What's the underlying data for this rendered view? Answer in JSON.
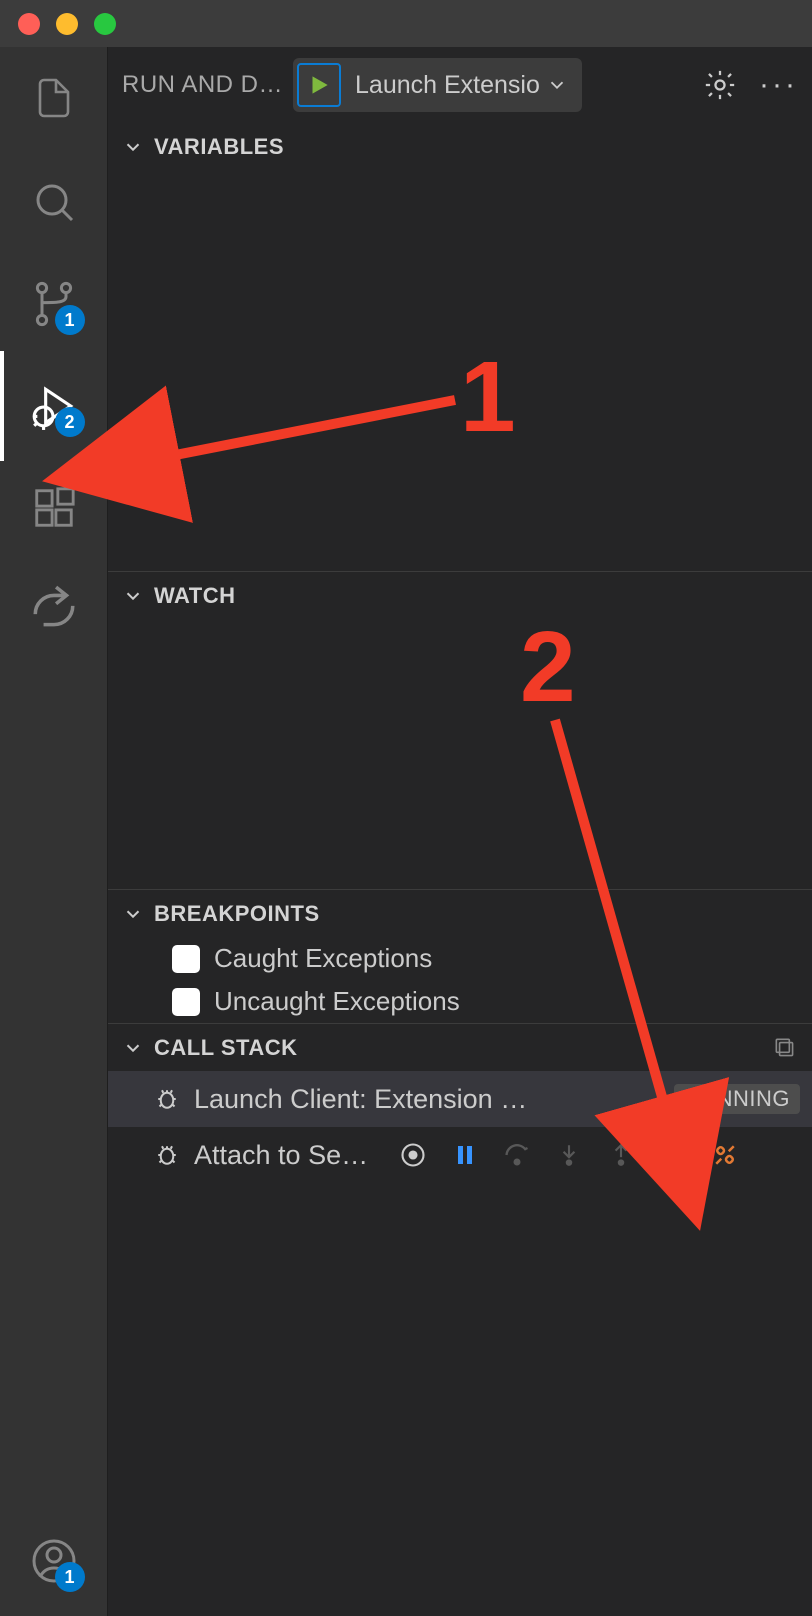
{
  "header": {
    "title": "RUN AND D…",
    "launch_config": "Launch Extensio"
  },
  "sections": {
    "variables": {
      "title": "VARIABLES"
    },
    "watch": {
      "title": "WATCH"
    },
    "breakpoints": {
      "title": "BREAKPOINTS",
      "items": [
        {
          "label": "Caught Exceptions",
          "checked": false
        },
        {
          "label": "Uncaught Exceptions",
          "checked": false
        }
      ]
    },
    "callstack": {
      "title": "CALL STACK",
      "items": [
        {
          "label": "Launch Client: Extension …",
          "status": "RUNNING"
        },
        {
          "label": "Attach to Se…"
        }
      ]
    }
  },
  "activity": {
    "scm_badge": "1",
    "debug_badge": "2",
    "account_badge": "1"
  },
  "annotations": {
    "one": "1",
    "two": "2"
  }
}
